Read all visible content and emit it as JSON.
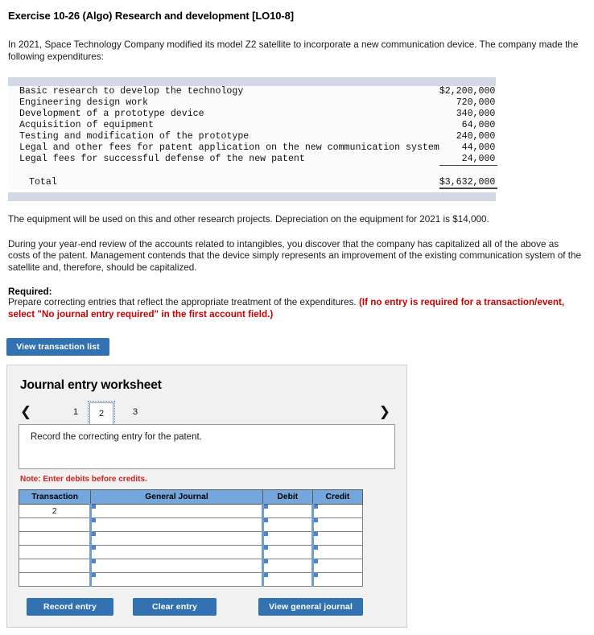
{
  "exercise": {
    "title": "Exercise 10-26 (Algo) Research and development [LO10-8]",
    "intro": "In 2021, Space Technology Company modified its model Z2 satellite to incorporate a new communication device. The company made the following expenditures:",
    "after_table_1": "The equipment will be used on this and other research projects. Depreciation on the equipment for 2021 is $14,000.",
    "after_table_2": "During your year-end review of the accounts related to intangibles, you discover that the company has capitalized all of the above as costs of the patent. Management contends that the device simply represents an improvement of the existing communication system of the satellite and, therefore, should be capitalized.",
    "required_label": "Required:",
    "required_text": "Prepare correcting entries that reflect the appropriate treatment of the expenditures. ",
    "required_emph": "(If no entry is required for a transaction/event, select \"No journal entry required\" in the first account field.)"
  },
  "expenditures": {
    "rows": [
      {
        "desc": "Basic research to develop the technology",
        "amount": "$2,200,000"
      },
      {
        "desc": "Engineering design work",
        "amount": "720,000"
      },
      {
        "desc": "Development of a prototype device",
        "amount": "340,000"
      },
      {
        "desc": "Acquisition of equipment",
        "amount": "64,000"
      },
      {
        "desc": "Testing and modification of the prototype",
        "amount": "240,000"
      },
      {
        "desc": "Legal and other fees for patent application on the new communication system",
        "amount": "44,000"
      },
      {
        "desc": "Legal fees for successful defense of the new patent",
        "amount": "24,000"
      }
    ],
    "total_label": "Total",
    "total_amount": "$3,632,000"
  },
  "buttons": {
    "view_transaction_list": "View transaction list",
    "record_entry": "Record entry",
    "clear_entry": "Clear entry",
    "view_general_journal_pre": "View ",
    "view_general_journal_u": "g",
    "view_general_journal_post": "eneral journal"
  },
  "worksheet": {
    "title": "Journal entry worksheet",
    "prev_icon": "❮",
    "next_icon": "❯",
    "tabs": [
      {
        "label": "1",
        "selected": false
      },
      {
        "label": "2",
        "selected": true
      },
      {
        "label": "3",
        "selected": false
      }
    ],
    "prompt": "Record the correcting entry for the patent.",
    "note": "Note: Enter debits before credits.",
    "table": {
      "headers": [
        "Transaction",
        "General Journal",
        "Debit",
        "Credit"
      ],
      "rows": [
        {
          "transaction": "2",
          "general_journal": "",
          "debit": "",
          "credit": ""
        },
        {
          "transaction": "",
          "general_journal": "",
          "debit": "",
          "credit": ""
        },
        {
          "transaction": "",
          "general_journal": "",
          "debit": "",
          "credit": ""
        },
        {
          "transaction": "",
          "general_journal": "",
          "debit": "",
          "credit": ""
        },
        {
          "transaction": "",
          "general_journal": "",
          "debit": "",
          "credit": ""
        },
        {
          "transaction": "",
          "general_journal": "",
          "debit": "",
          "credit": ""
        }
      ]
    }
  },
  "colors": {
    "button_blue": "#3272b0",
    "table_header_blue": "#72a6dc",
    "band_grey": "#d2d8e4",
    "note_red": "#cc2222",
    "panel_grey": "#f1f1f1"
  }
}
